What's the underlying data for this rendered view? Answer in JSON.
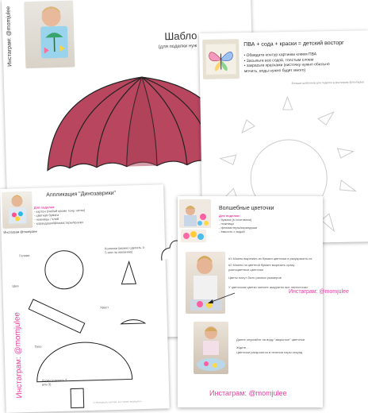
{
  "umbrella_sheet": {
    "instagram_vertical": "Инстаграм: @momjulee",
    "title": "Шабло",
    "subtitle": "(для поделки нуж",
    "colors": {
      "umbrella_dark": "#b2425b",
      "umbrella_light": "#c9566e"
    }
  },
  "pva_sheet": {
    "title": "ПВА + сода + краски = детский восторг",
    "steps": [
      "Обведите контур картинки клеем ПВА",
      "Засыпьте все содой, толстым слоем",
      "закрасьте красками (кисточку нужно обильно мочить, воды нужно будет много)"
    ],
    "footer": "Больше шаблонов для поделок в инстаграм @momjulee"
  },
  "dino_sheet": {
    "title": "Аппликация \"Динозаврики\"",
    "materials_heading": "Для поделки:",
    "materials": [
      "- картон (любой кроме тону, нитки)",
      "- цветная бумага",
      "- ножницы / клей",
      "- карандаши/фломастеры/краски"
    ],
    "photo_caption": "Инстаграм @momjulee",
    "labels": {
      "head": "Голова",
      "horns": "Колючки (можно сделать 4-5 или по желанию)",
      "neck": "Шея",
      "tail": "Хвост",
      "body": "Тело",
      "legs": "Лапки (сделать 2 или 3)"
    },
    "instagram_vertical": "Инстаграм: @momjulee",
    "footer": "© Материалы автора, все права защищены"
  },
  "flower_sheet": {
    "title": "Волшебные цветочки",
    "materials_heading": "Для поделки:",
    "materials": [
      "- бумага (в сочетании)",
      "- ножницы",
      "- фломастеры/карандаши",
      "- ёмкость с водой"
    ],
    "instructions": [
      "#1 Можно вырезать из бумаги цветочки в разукрасить их",
      "#2 Можно на цветной бумаге вырезать сразу разноцветные цветочки",
      "Цветы могут быть разных размеров",
      "У цветочков цветки загните аккуратно все лепесточки"
    ],
    "water_text": [
      "Далее опускайте на воду \"закрытые\" цветочки",
      "Ждите...",
      "Цветочки раскроются в течении пары секунд"
    ],
    "instagram_footer": "Инстаграм: @momjulee"
  }
}
